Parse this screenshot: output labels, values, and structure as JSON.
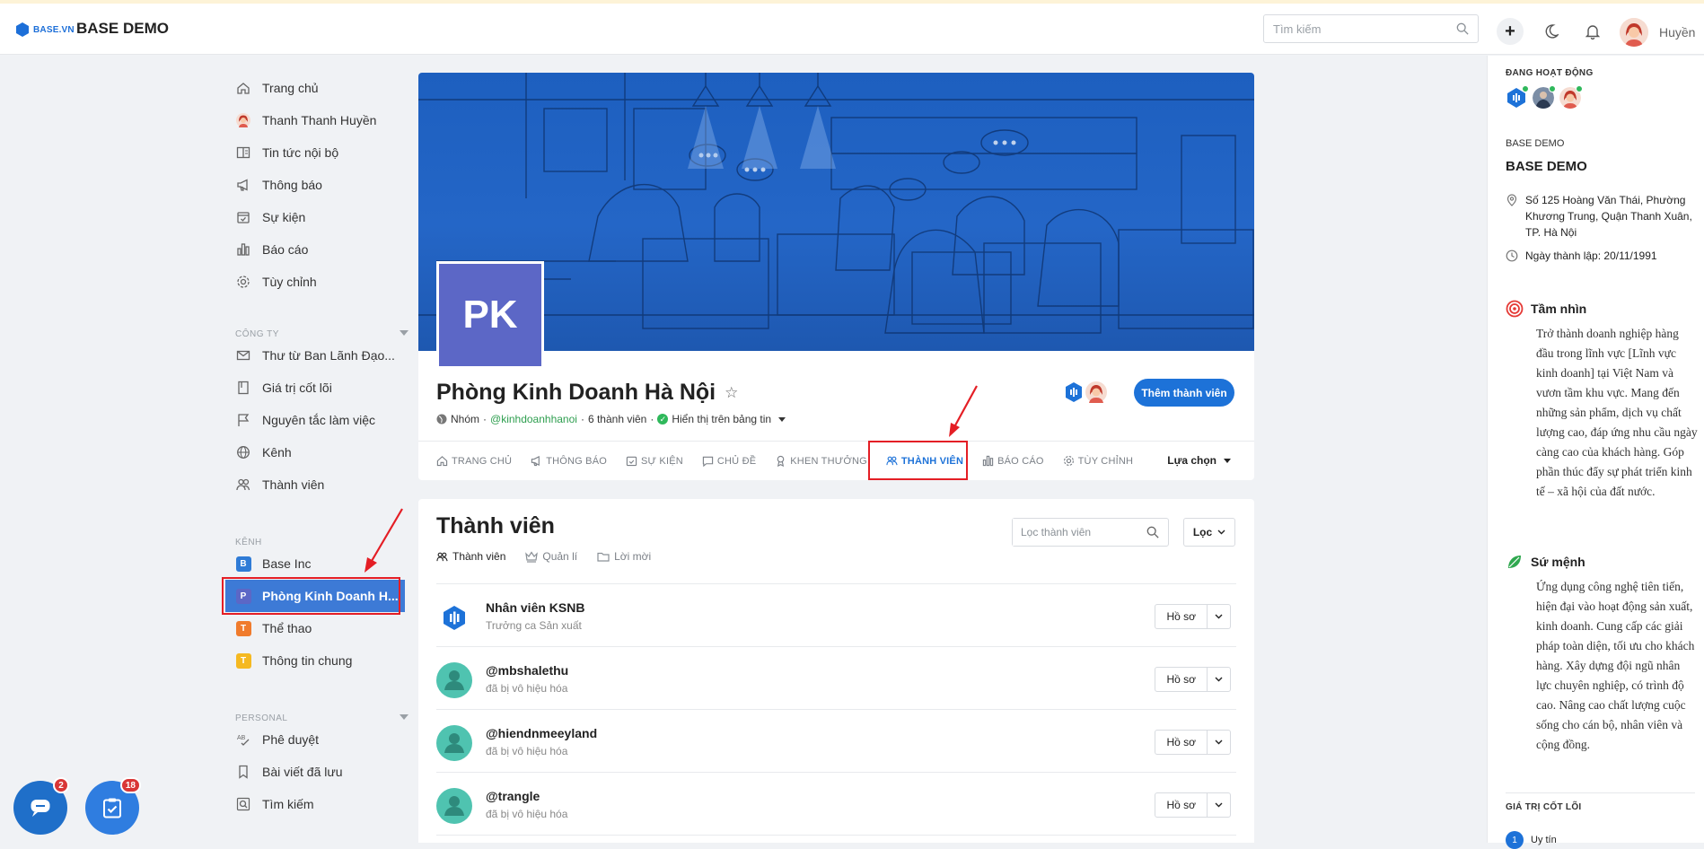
{
  "header": {
    "logo_text": "BASE.VN",
    "app_title": "BASE DEMO",
    "search_placeholder": "Tìm kiếm",
    "user_name": "Huyền"
  },
  "sidebar": {
    "main_items": [
      {
        "label": "Trang chủ",
        "icon": "home-icon"
      },
      {
        "label": "Thanh Thanh Huyền",
        "icon": "avatar"
      },
      {
        "label": "Tin tức nội bộ",
        "icon": "news-icon"
      },
      {
        "label": "Thông báo",
        "icon": "megaphone-icon"
      },
      {
        "label": "Sự kiện",
        "icon": "calendar-check-icon"
      },
      {
        "label": "Báo cáo",
        "icon": "bar-chart-icon"
      },
      {
        "label": "Tùy chỉnh",
        "icon": "gear-icon"
      }
    ],
    "company_section": "CÔNG TY",
    "company_items": [
      {
        "label": "Thư từ Ban Lãnh Đạo...",
        "icon": "mail-icon"
      },
      {
        "label": "Giá trị cốt lõi",
        "icon": "book-icon"
      },
      {
        "label": "Nguyên tắc làm việc",
        "icon": "flag-icon"
      },
      {
        "label": "Kênh",
        "icon": "globe-icon"
      },
      {
        "label": "Thành viên",
        "icon": "users-icon"
      }
    ],
    "channel_section": "KÊNH",
    "channel_items": [
      {
        "label": "Base Inc",
        "badge": "B",
        "color": "#2f7bd6"
      },
      {
        "label": "Phòng Kinh Doanh H...",
        "badge": "P",
        "color": "#5c67c6"
      },
      {
        "label": "Thể thao",
        "badge": "T",
        "color": "#f07b2c"
      },
      {
        "label": "Thông tin chung",
        "badge": "T",
        "color": "#f5b921"
      }
    ],
    "personal_section": "PERSONAL",
    "personal_items": [
      {
        "label": "Phê duyệt",
        "icon": "approve-icon"
      },
      {
        "label": "Bài viết đã lưu",
        "icon": "bookmark-icon"
      },
      {
        "label": "Tìm kiếm",
        "icon": "search-icon"
      }
    ]
  },
  "group": {
    "initials": "PK",
    "name": "Phòng Kinh Doanh Hà Nội",
    "type": "Nhóm",
    "handle": "@kinhdoanhhanoi",
    "member_count": "6 thành viên",
    "visibility": "Hiển thị trên bảng tin",
    "add_member_label": "Thêm thành viên",
    "tabs": [
      {
        "label": "TRANG CHỦ",
        "icon": "home-icon"
      },
      {
        "label": "THÔNG BÁO",
        "icon": "megaphone-icon"
      },
      {
        "label": "SỰ KIỆN",
        "icon": "calendar-check-icon"
      },
      {
        "label": "CHỦ ĐỀ",
        "icon": "chat-icon"
      },
      {
        "label": "KHEN THƯỞNG",
        "icon": "award-icon"
      },
      {
        "label": "THÀNH VIÊN",
        "icon": "users-icon"
      },
      {
        "label": "BÁO CÁO",
        "icon": "bar-chart-icon"
      },
      {
        "label": "TÙY CHỈNH",
        "icon": "gear-icon"
      }
    ],
    "more_label": "Lựa chọn"
  },
  "members": {
    "title": "Thành viên",
    "subtabs": [
      "Thành viên",
      "Quản lí",
      "Lời mời"
    ],
    "filter_placeholder": "Lọc thành viên",
    "filter_button": "Lọc",
    "profile_label": "Hồ sơ",
    "rows": [
      {
        "name": "Nhân viên KSNB",
        "sub": "Trưởng ca Sản xuất",
        "avatar": "base-logo"
      },
      {
        "name": "@mbshalethu",
        "sub": "đã bị vô hiệu hóa",
        "avatar": "default"
      },
      {
        "name": "@hiendnmeeyland",
        "sub": "đã bị vô hiệu hóa",
        "avatar": "default"
      },
      {
        "name": "@trangle",
        "sub": "đã bị vô hiệu hóa",
        "avatar": "default"
      }
    ]
  },
  "right_panel": {
    "active_label": "ĐANG HOẠT ĐỘNG",
    "org_small": "BASE DEMO",
    "org_name": "BASE DEMO",
    "address": "Số 125 Hoàng Văn Thái, Phường Khương Trung, Quận Thanh Xuân, TP. Hà Nội",
    "founded": "Ngày thành lập: 20/11/1991",
    "vision_title": "Tầm nhìn",
    "vision_text": "Trở thành doanh nghiệp hàng đầu trong lĩnh vực [Lĩnh vực kinh doanh] tại Việt Nam và vươn tầm khu vực. Mang đến những sản phẩm, dịch vụ chất lượng cao, đáp ứng nhu cầu ngày càng cao của khách hàng. Góp phần thúc đẩy sự phát triển kinh tế – xã hội của đất nước.",
    "mission_title": "Sứ mệnh",
    "mission_text": "Ứng dụng công nghệ tiên tiến, hiện đại vào hoạt động sản xuất, kinh doanh. Cung cấp các giải pháp toàn diện, tối ưu cho khách hàng. Xây dựng đội ngũ nhân lực chuyên nghiệp, có trình độ cao. Nâng cao chất lượng cuộc sống cho cán bộ, nhân viên và cộng đồng.",
    "core_values_label": "GIÁ TRỊ CỐT LÕI",
    "core_value_1_num": "1",
    "core_value_1": "Uy tín"
  },
  "floating": {
    "chat_count": "2",
    "tasks_count": "18"
  },
  "colors": {
    "accent": "#1d72d8",
    "highlight_red": "#e41e25",
    "online_green": "#2fb85b"
  }
}
